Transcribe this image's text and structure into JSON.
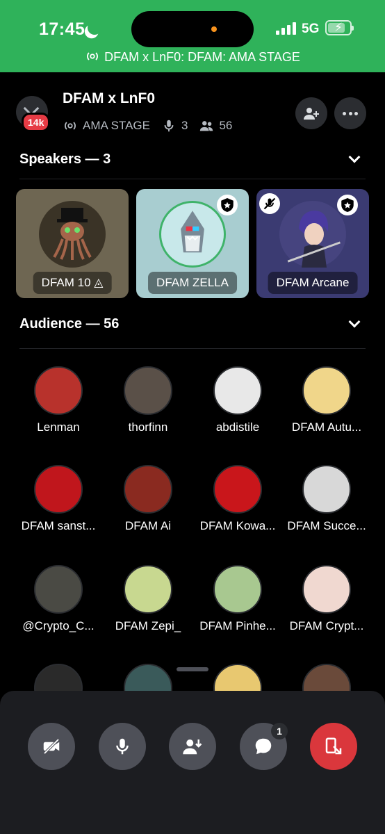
{
  "status_bar": {
    "time": "17:45",
    "network": "5G",
    "banner": "DFAM x LnF0: DFAM: AMA STAGE",
    "color": "#2fb25a"
  },
  "header": {
    "title": "DFAM x LnF0",
    "stage_name": "AMA STAGE",
    "speaker_count": "3",
    "listener_count": "56",
    "unread_badge": "14k"
  },
  "speakers_section": {
    "title": "Speakers — 3",
    "items": [
      {
        "name": "DFAM 10 ◬",
        "bg": "#6e6652",
        "avatar_color": "#3a3326",
        "icon": "octopus-avatar"
      },
      {
        "name": "DFAM ZELLA",
        "bg": "#a8cdd0",
        "avatar_color": "#c8e8ea",
        "icon": "shark-avatar",
        "moderator": true
      },
      {
        "name": "DFAM Arcane",
        "bg": "#3b3b72",
        "avatar_color": "#46447f",
        "icon": "anime-avatar",
        "moderator": true,
        "muted": true
      }
    ]
  },
  "audience_section": {
    "title": "Audience — 56",
    "items": [
      {
        "name": "Lenman",
        "color": "#b8322c"
      },
      {
        "name": "thorfinn",
        "color": "#5a5048"
      },
      {
        "name": "abdistile",
        "color": "#e8e8e8"
      },
      {
        "name": "DFAM Autu...",
        "color": "#f0d68a"
      },
      {
        "name": "DFAM sanst...",
        "color": "#c0161c"
      },
      {
        "name": "DFAM Ai",
        "color": "#8a2a20"
      },
      {
        "name": "DFAM Kowa...",
        "color": "#c9161b"
      },
      {
        "name": "DFAM Succe...",
        "color": "#d8d8d8"
      },
      {
        "name": "@Crypto_C...",
        "color": "#4a4a44"
      },
      {
        "name": "DFAM Zepi_",
        "color": "#c8d890"
      },
      {
        "name": "DFAM Pinhe...",
        "color": "#a8c890"
      },
      {
        "name": "DFAM Crypt...",
        "color": "#f0d8d0"
      },
      {
        "name": "",
        "color": "#2a2a2a"
      },
      {
        "name": "",
        "color": "#3a5a5a"
      },
      {
        "name": "",
        "color": "#e8c870"
      },
      {
        "name": "",
        "color": "#6a4a3a"
      }
    ]
  },
  "controls": {
    "chat_badge": "1",
    "leave_color": "#da373c"
  }
}
